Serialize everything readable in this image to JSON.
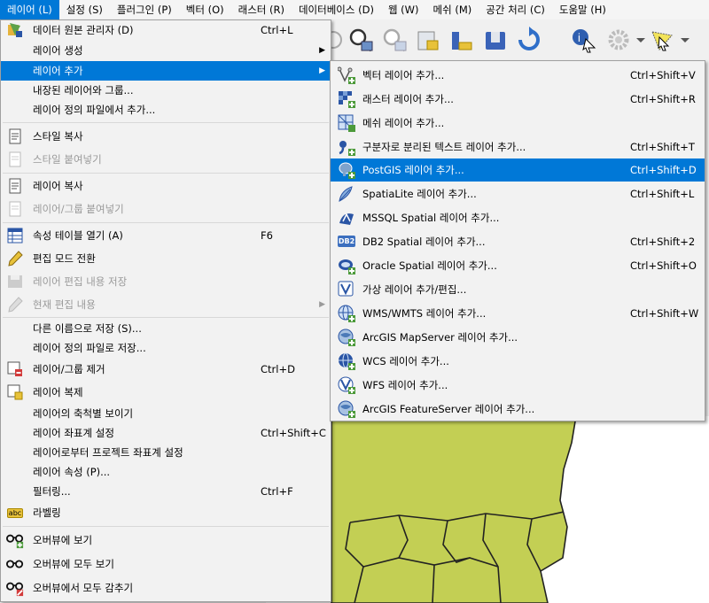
{
  "menubar": {
    "items": [
      {
        "label": "레이어 (L)",
        "active": true
      },
      {
        "label": "설정 (S)"
      },
      {
        "label": "플러그인 (P)"
      },
      {
        "label": "벡터 (O)"
      },
      {
        "label": "래스터 (R)"
      },
      {
        "label": "데이터베이스 (D)"
      },
      {
        "label": "웹 (W)"
      },
      {
        "label": "메쉬 (M)"
      },
      {
        "label": "공간 처리 (C)"
      },
      {
        "label": "도움말 (H)"
      }
    ]
  },
  "layer_menu": {
    "items": [
      {
        "label": "데이터 원본 관리자 (D)",
        "shortcut": "Ctrl+L",
        "icon": "data-source-manager-icon"
      },
      {
        "label": "레이어 생성",
        "shortcut": "",
        "submenu": true
      },
      {
        "label": "레이어 추가",
        "shortcut": "",
        "submenu": true,
        "highlighted": true
      },
      {
        "label": "내장된 레이어와 그룹...",
        "shortcut": ""
      },
      {
        "label": "레이어 정의 파일에서 추가...",
        "shortcut": ""
      },
      {
        "label": "스타일 복사",
        "shortcut": "",
        "icon": "copy-style-icon"
      },
      {
        "label": "스타일 붙여넣기",
        "shortcut": "",
        "disabled": true,
        "icon": "paste-style-icon"
      },
      {
        "label": "레이어 복사",
        "shortcut": "",
        "icon": "copy-layer-icon"
      },
      {
        "label": "레이어/그룹 붙여넣기",
        "shortcut": "",
        "disabled": true,
        "icon": "paste-layer-icon"
      },
      {
        "label": "속성 테이블 열기 (A)",
        "shortcut": "F6",
        "icon": "attribute-table-icon"
      },
      {
        "label": "편집 모드 전환",
        "shortcut": "",
        "icon": "pencil-icon"
      },
      {
        "label": "레이어 편집 내용 저장",
        "shortcut": "",
        "disabled": true,
        "icon": "save-edits-icon"
      },
      {
        "label": "현재 편집 내용",
        "shortcut": "",
        "disabled": true,
        "submenu": true,
        "icon": "current-edits-icon"
      },
      {
        "label": "다른 이름으로 저장 (S)...",
        "shortcut": ""
      },
      {
        "label": "레이어 정의 파일로 저장...",
        "shortcut": ""
      },
      {
        "label": "레이어/그룹 제거",
        "shortcut": "Ctrl+D",
        "icon": "remove-layer-icon"
      },
      {
        "label": "레이어 복제",
        "shortcut": "",
        "icon": "duplicate-layer-icon"
      },
      {
        "label": "레이어의 축척별 보이기",
        "shortcut": ""
      },
      {
        "label": "레이어 좌표계 설정",
        "shortcut": "Ctrl+Shift+C"
      },
      {
        "label": "레이어로부터 프로젝트 좌표계 설정",
        "shortcut": ""
      },
      {
        "label": "레이어 속성 (P)...",
        "shortcut": ""
      },
      {
        "label": "필터링...",
        "shortcut": "Ctrl+F"
      },
      {
        "label": "라벨링",
        "shortcut": "",
        "icon": "labeling-icon",
        "icon_text": "abc"
      },
      {
        "label": "오버뷰에 보기",
        "shortcut": "",
        "icon": "overview-show-icon"
      },
      {
        "label": "오버뷰에 모두 보기",
        "shortcut": "",
        "icon": "overview-show-all-icon"
      },
      {
        "label": "오버뷰에서 모두 감추기",
        "shortcut": "",
        "icon": "overview-hide-all-icon"
      }
    ]
  },
  "add_layer_submenu": {
    "items": [
      {
        "label": "벡터 레이어 추가...",
        "shortcut": "Ctrl+Shift+V",
        "icon": "vector-layer-icon"
      },
      {
        "label": "래스터 레이어 추가...",
        "shortcut": "Ctrl+Shift+R",
        "icon": "raster-layer-icon"
      },
      {
        "label": "메쉬 레이어 추가...",
        "shortcut": "",
        "icon": "mesh-layer-icon"
      },
      {
        "label": "구분자로 분리된 텍스트 레이어 추가...",
        "shortcut": "Ctrl+Shift+T",
        "icon": "delimited-text-icon"
      },
      {
        "label": "PostGIS 레이어 추가...",
        "shortcut": "Ctrl+Shift+D",
        "icon": "postgis-elephant-icon",
        "highlighted": true
      },
      {
        "label": "SpatiaLite 레이어 추가...",
        "shortcut": "Ctrl+Shift+L",
        "icon": "spatialite-feather-icon"
      },
      {
        "label": "MSSQL Spatial 레이어 추가...",
        "shortcut": "",
        "icon": "mssql-icon"
      },
      {
        "label": "DB2 Spatial 레이어 추가...",
        "shortcut": "Ctrl+Shift+2",
        "icon": "db2-icon",
        "icon_text": "DB2"
      },
      {
        "label": "Oracle Spatial 레이어 추가...",
        "shortcut": "Ctrl+Shift+O",
        "icon": "oracle-icon"
      },
      {
        "label": "가상 레이어 추가/편집...",
        "shortcut": "",
        "icon": "virtual-layer-icon"
      },
      {
        "label": "WMS/WMTS 레이어 추가...",
        "shortcut": "Ctrl+Shift+W",
        "icon": "wms-globe-icon"
      },
      {
        "label": "ArcGIS MapServer 레이어 추가...",
        "shortcut": "",
        "icon": "arcgis-mapserver-icon"
      },
      {
        "label": "WCS 레이어 추가...",
        "shortcut": "",
        "icon": "wcs-globe-icon"
      },
      {
        "label": "WFS 레이어 추가...",
        "shortcut": "",
        "icon": "wfs-globe-icon"
      },
      {
        "label": "ArcGIS FeatureServer 레이어 추가...",
        "shortcut": "",
        "icon": "arcgis-featureserver-icon"
      }
    ]
  },
  "colors": {
    "highlight": "#0078d7",
    "map_fill": "#c3cf54",
    "map_border": "#222222",
    "menu_bg": "#f2f2f2"
  }
}
